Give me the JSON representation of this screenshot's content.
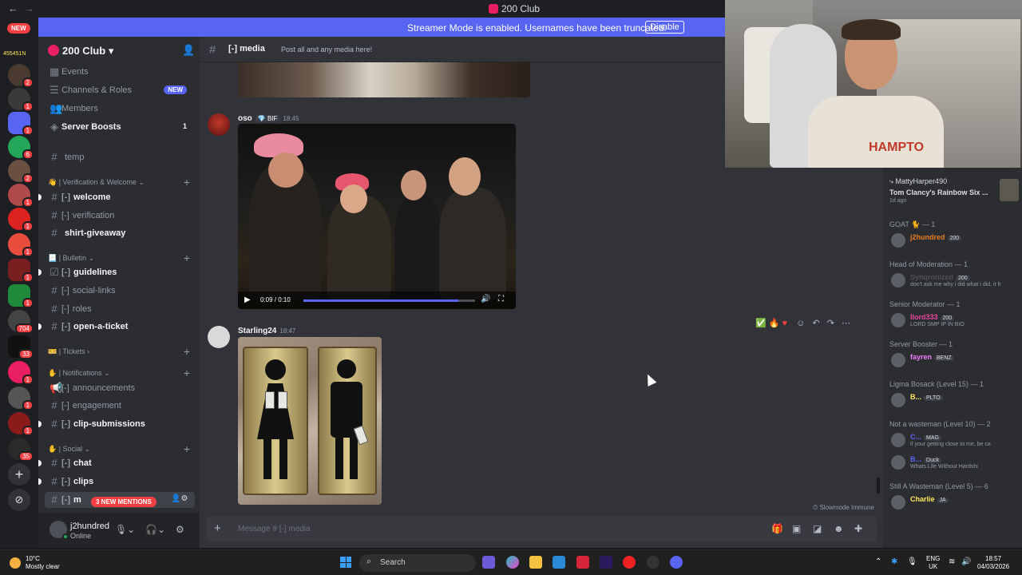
{
  "titlebar": {
    "title": "200 Club"
  },
  "banner": {
    "text": "Streamer Mode is enabled. Usernames have been truncated.",
    "button": "Disable"
  },
  "guilds": {
    "new_badge": "NEW",
    "user_tag": "455451N",
    "badges": [
      "2",
      "1",
      "1",
      "6",
      "2",
      "1",
      "1",
      "1",
      "1",
      "1",
      "704",
      "33",
      "1",
      "1",
      "1",
      "35"
    ]
  },
  "server": {
    "name": "200 Club",
    "chevron": "▾"
  },
  "sidebar": {
    "events": "Events",
    "channels_roles": "Channels & Roles",
    "channels_roles_badge": "NEW",
    "members": "Members",
    "server_boosts": "Server Boosts",
    "server_boosts_count": "1",
    "channels": [
      {
        "prefix": "",
        "name": "temp"
      },
      {
        "prefix": "[-]",
        "name": "welcome"
      },
      {
        "prefix": "[-]",
        "name": "verification"
      },
      {
        "prefix": "",
        "name": "shirt-giveaway"
      },
      {
        "prefix": "[-]",
        "name": "guidelines"
      },
      {
        "prefix": "[-]",
        "name": "social-links"
      },
      {
        "prefix": "[-]",
        "name": "roles"
      },
      {
        "prefix": "[-]",
        "name": "open-a-ticket"
      },
      {
        "prefix": "[-]",
        "name": "announcements"
      },
      {
        "prefix": "[-]",
        "name": "engagement"
      },
      {
        "prefix": "[-]",
        "name": "clip-submissions"
      },
      {
        "prefix": "[-]",
        "name": "chat"
      },
      {
        "prefix": "[-]",
        "name": "clips"
      },
      {
        "prefix": "[-]",
        "name": "m"
      }
    ],
    "categories": [
      "| Verification & Welcome",
      "| Bulletin",
      "| Tickets",
      "| Notifications",
      "| Social"
    ],
    "mentions_pill": "3 NEW MENTIONS"
  },
  "user": {
    "name": "j2hundred",
    "status": "Online"
  },
  "channel": {
    "prefix": "[-]",
    "name": "media",
    "topic": "Post all and any media here!"
  },
  "messages": [
    {
      "author": "oso",
      "tag": "BIF",
      "time": "18:45",
      "video_time": "0:09 / 0:10",
      "video_progress": 0.9
    },
    {
      "author": "Starling24",
      "time": "18:47"
    }
  ],
  "composer": {
    "placeholder": "Message # [-] media"
  },
  "slowmode": "Slowmode Immune",
  "members": {
    "activity": {
      "user": "MattyHarper490",
      "game": "Tom Clancy's Rainbow Six ...",
      "ago": "1d ago"
    },
    "roles": [
      {
        "title": "GOAT 🐈 — 1",
        "members": [
          {
            "name": "j2hundred",
            "tag": "200",
            "sub": "",
            "color": "#e67e22"
          }
        ]
      },
      {
        "title": "Head of Moderation — 1",
        "members": [
          {
            "name": "Synqronized",
            "tag": "200",
            "sub": "don't ask me why i did what i did, it h",
            "color": "#4e5058"
          }
        ]
      },
      {
        "title": "Senior Moderator — 1",
        "members": [
          {
            "name": "llord333",
            "tag": "200",
            "sub": "LORD SMP IP IN BIO",
            "color": "#eb459e"
          }
        ]
      },
      {
        "title": "Server Booster — 1",
        "members": [
          {
            "name": "fayren",
            "tag": "BENZ",
            "sub": "",
            "color": "#f47fff"
          }
        ]
      },
      {
        "title": "Ligma Bosack (Level 15) — 1",
        "members": [
          {
            "name": "B...",
            "tag": "PLTO",
            "sub": "",
            "color": "#fee75c"
          }
        ]
      },
      {
        "title": "Not a wasteman (Level 10) — 2",
        "members": [
          {
            "name": "C...",
            "tag": "MAG",
            "sub": "if your getting close to me, be ca",
            "color": "#5865f2"
          },
          {
            "name": "B...",
            "tag": "Duck",
            "sub": "Whats Life Without Hardshi",
            "color": "#5865f2"
          }
        ]
      },
      {
        "title": "Still A Wasteman (Level 5) — 6",
        "members": [
          {
            "name": "Charlie",
            "tag": "JA",
            "sub": "",
            "color": "#fee75c"
          }
        ]
      }
    ]
  },
  "taskbar": {
    "weather_temp": "10°C",
    "weather_desc": "Mostly clear",
    "search": "Search",
    "lang_1": "ENG",
    "lang_2": "UK",
    "time": "18:57",
    "date": "04/03/2026"
  }
}
